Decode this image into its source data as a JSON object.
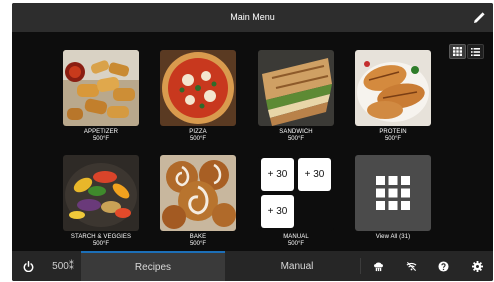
{
  "header": {
    "title": "Main Menu",
    "edit_icon": "pencil-icon"
  },
  "view_toggles": {
    "grid_icon": "grid-view-icon",
    "list_icon": "list-view-icon",
    "active": "grid"
  },
  "recipes": [
    {
      "name": "APPETIZER",
      "temp": "500°F",
      "image": "appetizer-photo"
    },
    {
      "name": "PIZZA",
      "temp": "500°F",
      "image": "pizza-photo"
    },
    {
      "name": "SANDWICH",
      "temp": "500°F",
      "image": "sandwich-photo"
    },
    {
      "name": "PROTEIN",
      "temp": "500°F",
      "image": "protein-photo"
    },
    {
      "name": "STARCH & VEGGIES",
      "temp": "500°F",
      "image": "starch-veggies-photo"
    },
    {
      "name": "BAKE",
      "temp": "500°F",
      "image": "bake-photo"
    },
    {
      "name": "MANUAL",
      "temp": "500°F",
      "buttons": [
        "+ 30",
        "+ 30",
        "+ 30"
      ]
    },
    {
      "name": "View All (31)",
      "icon": "apps-grid-icon"
    }
  ],
  "bottom_bar": {
    "power_icon": "power-icon",
    "temp": "500⁑",
    "tabs": [
      "Recipes",
      "Manual"
    ],
    "active_tab": "Recipes",
    "icons": [
      "chef-hat-icon",
      "wifi-off-icon",
      "help-icon",
      "settings-icon"
    ]
  },
  "colors": {
    "background": "#0d0d0d",
    "header": "#2d2d2d",
    "active_tab_accent": "#1c6fb8"
  }
}
